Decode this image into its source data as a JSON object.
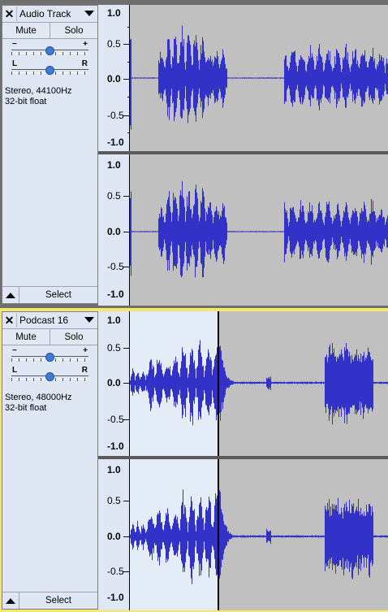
{
  "tracks": [
    {
      "name": "Audio Track",
      "mute_label": "Mute",
      "solo_label": "Solo",
      "gain_minus": "−",
      "gain_plus": "+",
      "pan_left": "L",
      "pan_right": "R",
      "info_line1": "Stereo, 44100Hz",
      "info_line2": "32-bit float",
      "select_label": "Select",
      "ruler": [
        "1.0",
        "0.5",
        "0.0",
        "-0.5",
        "-1.0"
      ],
      "colors": {
        "waveform": "#3232c8",
        "background": "#c0c0c0"
      }
    },
    {
      "name": "Podcast 16",
      "mute_label": "Mute",
      "solo_label": "Solo",
      "gain_minus": "−",
      "gain_plus": "+",
      "pan_left": "L",
      "pan_right": "R",
      "info_line1": "Stereo, 48000Hz",
      "info_line2": "32-bit float",
      "select_label": "Select",
      "ruler": [
        "1.0",
        "0.5",
        "0.0",
        "-0.5",
        "-1.0"
      ],
      "colors": {
        "waveform": "#3232c8",
        "selection": "#e4ecf7",
        "focus_border": "#f3e86b"
      }
    }
  ]
}
